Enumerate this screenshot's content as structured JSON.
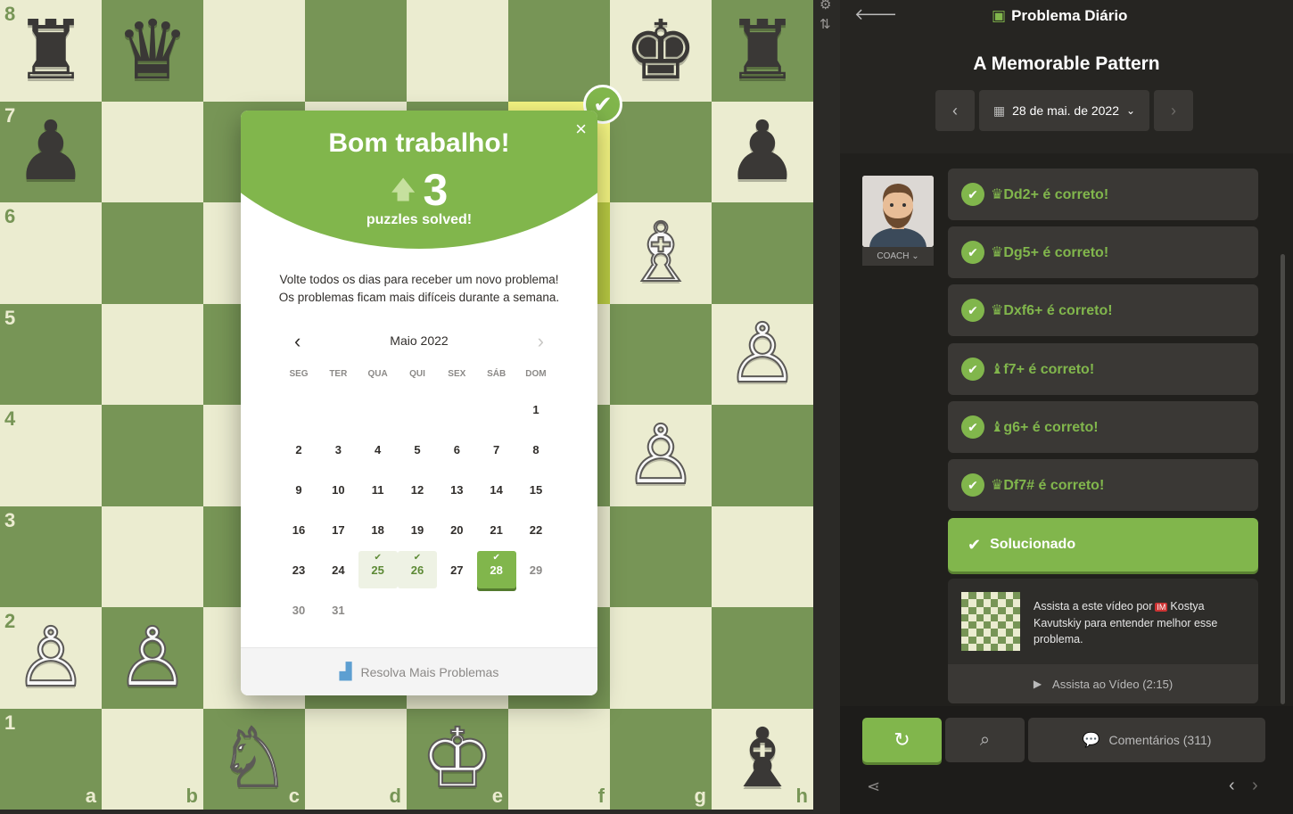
{
  "board": {
    "ranks": [
      "8",
      "7",
      "6",
      "5",
      "4",
      "3",
      "2",
      "1"
    ],
    "files": [
      "a",
      "b",
      "c",
      "d",
      "e",
      "f",
      "g",
      "h"
    ],
    "pieces": [
      {
        "sq": "a8",
        "glyph": "♜",
        "color": "black"
      },
      {
        "sq": "b8",
        "glyph": "♛",
        "color": "black"
      },
      {
        "sq": "g8",
        "glyph": "♚",
        "color": "black"
      },
      {
        "sq": "h8",
        "glyph": "♜",
        "color": "black"
      },
      {
        "sq": "a7",
        "glyph": "♟",
        "color": "black"
      },
      {
        "sq": "h7",
        "glyph": "♟",
        "color": "black"
      },
      {
        "sq": "g6",
        "glyph": "♗",
        "color": "white"
      },
      {
        "sq": "h5",
        "glyph": "♙",
        "color": "white"
      },
      {
        "sq": "g4",
        "glyph": "♙",
        "color": "white"
      },
      {
        "sq": "a2",
        "glyph": "♙",
        "color": "white"
      },
      {
        "sq": "b2",
        "glyph": "♙",
        "color": "white"
      },
      {
        "sq": "c1",
        "glyph": "♘",
        "color": "white"
      },
      {
        "sq": "e1",
        "glyph": "♔",
        "color": "white"
      },
      {
        "sq": "h1",
        "glyph": "♝",
        "color": "black"
      }
    ],
    "highlight": [
      "f7",
      "f6"
    ],
    "light_color": "#ebecd0",
    "dark_color": "#779556"
  },
  "modal": {
    "title": "Bom trabalho!",
    "close": "×",
    "score": "3",
    "score_arrow": "🡅",
    "subtitle": "puzzles solved!",
    "message_line1": "Volte todos os dias para receber um novo problema!",
    "message_line2": "Os problemas ficam mais difíceis durante a semana.",
    "calendar": {
      "month": "Maio 2022",
      "prev": "‹",
      "next": "›",
      "weekdays": [
        "SEG",
        "TER",
        "QUA",
        "QUI",
        "SEX",
        "SÁB",
        "DOM"
      ],
      "weeks": [
        [
          "",
          "",
          "",
          "",
          "",
          "",
          "1"
        ],
        [
          "2",
          "3",
          "4",
          "5",
          "6",
          "7",
          "8"
        ],
        [
          "9",
          "10",
          "11",
          "12",
          "13",
          "14",
          "15"
        ],
        [
          "16",
          "17",
          "18",
          "19",
          "20",
          "21",
          "22"
        ],
        [
          "23",
          "24",
          "25",
          "26",
          "27",
          "28",
          "29"
        ],
        [
          "30",
          "31",
          "",
          "",
          "",
          "",
          ""
        ]
      ],
      "solved_days": [
        "25",
        "26"
      ],
      "today": "28",
      "muted_days": [
        "29",
        "30",
        "31"
      ]
    },
    "footer_label": "Resolva Mais Problemas",
    "badge": "✔"
  },
  "panel": {
    "brand": "Problema Diário",
    "puzzle_title": "A Memorable Pattern",
    "date": "28 de mai. de 2022",
    "coach_label": "COACH ⌄",
    "moves": [
      "♛Dd2+ é correto!",
      "♛Dg5+ é correto!",
      "♛Dxf6+ é correto!",
      "♝f7+ é correto!",
      "♝g6+ é correto!",
      "♛Df7# é correto!"
    ],
    "solved_label": "Solucionado",
    "video": {
      "text_before": "Assista a este vídeo por",
      "title_badge": "IM",
      "text_after": "Kostya Kavutskiy para entender melhor esse problema.",
      "watch_label": "Assista ao Vídeo (2:15)"
    },
    "comments_label": "Comentários",
    "comments_count": "(311)",
    "accent": "#81b64c"
  }
}
